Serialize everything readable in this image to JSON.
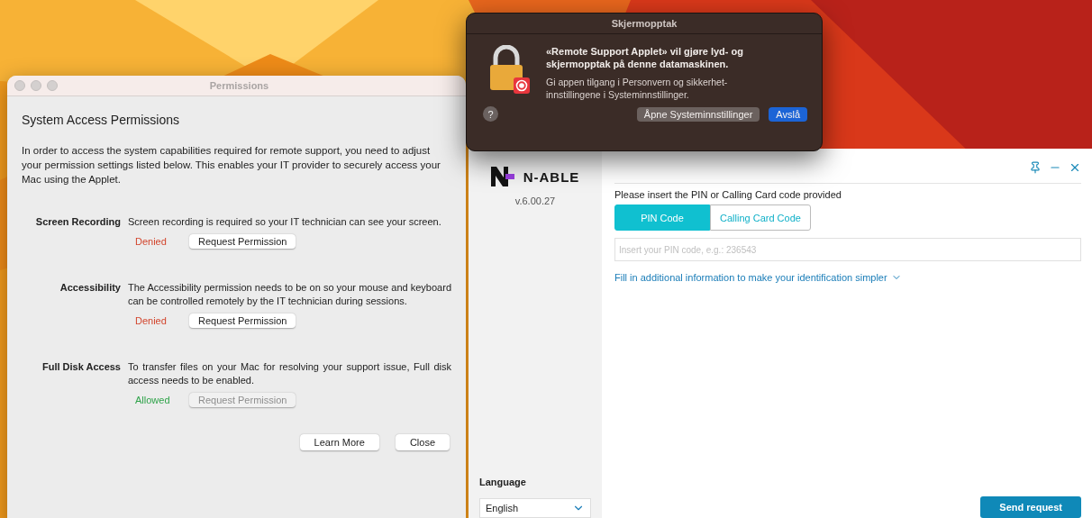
{
  "permissions_window": {
    "title": "Permissions",
    "heading": "System Access Permissions",
    "intro": "In order to access the system capabilities required for remote support, you need to adjust your permission settings listed below. This enables your IT provider to securely access your Mac using the Applet.",
    "sections": [
      {
        "name": "Screen Recording",
        "description": "Screen recording is required so your IT technician can see your screen.",
        "status": "Denied",
        "granted": false,
        "button": {
          "label": "Request Permission",
          "disabled": false
        }
      },
      {
        "name": "Accessibility",
        "description": "The Accessibility permission needs to be on so your mouse and keyboard can be controlled remotely by the IT technician during sessions.",
        "status": "Denied",
        "granted": false,
        "button": {
          "label": "Request Permission",
          "disabled": false
        }
      },
      {
        "name": "Full Disk Access",
        "description": "To transfer files on your Mac for resolving your support issue, Full disk access needs to be enabled.",
        "status": "Allowed",
        "granted": true,
        "button": {
          "label": "Request Permission",
          "disabled": true
        }
      }
    ],
    "buttons": [
      "Learn More",
      "Close"
    ]
  },
  "alert_dialog": {
    "title": "Skjermopptak",
    "message": "«Remote Support Applet» vil gjøre lyd- og skjermopptak på denne datamaskinen.",
    "detail": "Gi appen tilgang i Personvern og sikkerhet-innstillingene i Systeminnstillinger.",
    "help": "?",
    "buttons": [
      {
        "label": "Åpne Systeminnstillinger",
        "kind": "secondary"
      },
      {
        "label": "Avslå",
        "kind": "primary"
      }
    ]
  },
  "nable_window": {
    "logo": "N-ABLE",
    "version": "v.6.00.27",
    "prompt": "Please insert the PIN or Calling Card code provided",
    "tabs": [
      {
        "label": "PIN Code",
        "selected": true
      },
      {
        "label": "Calling Card Code",
        "selected": false
      }
    ],
    "pin_field": {
      "placeholder": "Insert your PIN code, e.g.: 236543"
    },
    "more_info_link": "Fill in additional information to make your identification simpler",
    "language": {
      "label": "Language",
      "value": "English"
    },
    "send_button": "Send request"
  }
}
